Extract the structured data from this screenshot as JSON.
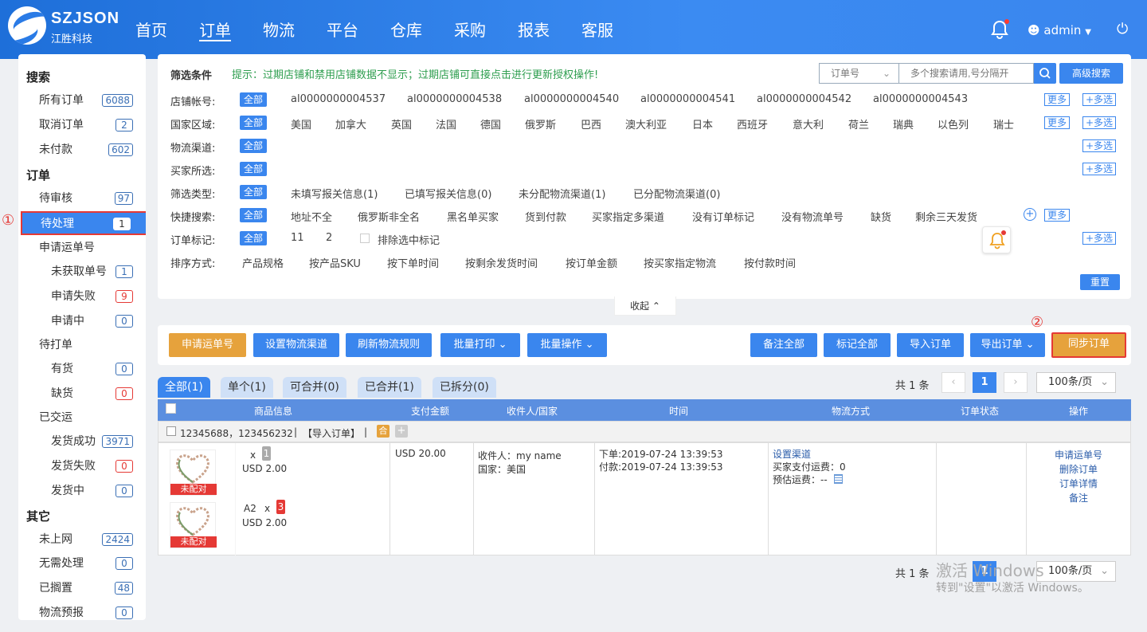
{
  "app": {
    "brand": "SZJSON",
    "brand_sub": "江胜科技"
  },
  "nav": [
    "首页",
    "订单",
    "物流",
    "平台",
    "仓库",
    "采购",
    "报表",
    "客服"
  ],
  "user": {
    "name": "admin"
  },
  "sidebar": {
    "search_heading": "搜索",
    "search_items": [
      {
        "label": "所有订单",
        "count": "6088"
      },
      {
        "label": "取消订单",
        "count": "2"
      },
      {
        "label": "未付款",
        "count": "602"
      }
    ],
    "order_heading": "订单",
    "order_items": [
      {
        "label": "待审核",
        "count": "97"
      },
      {
        "label": "待处理",
        "count": "1"
      }
    ],
    "apply_label": "申请运单号",
    "apply_items": [
      {
        "label": "未获取单号",
        "count": "1"
      },
      {
        "label": "申请失败",
        "count": "9"
      },
      {
        "label": "申请中",
        "count": "0"
      }
    ],
    "print_label": "待打单",
    "print_items": [
      {
        "label": "有货",
        "count": "0"
      },
      {
        "label": "缺货",
        "count": "0"
      }
    ],
    "shipped_label": "已交运",
    "shipped_items": [
      {
        "label": "发货成功",
        "count": "3971"
      },
      {
        "label": "发货失败",
        "count": "0"
      },
      {
        "label": "发货中",
        "count": "0"
      }
    ],
    "other_heading": "其它",
    "other_items": [
      {
        "label": "未上网",
        "count": "2424"
      },
      {
        "label": "无需处理",
        "count": "0"
      },
      {
        "label": "已搁置",
        "count": "48"
      },
      {
        "label": "物流预报",
        "count": "0"
      }
    ]
  },
  "markers": {
    "one": "①",
    "two": "②"
  },
  "filter": {
    "title": "筛选条件",
    "tip": "提示：过期店铺和禁用店铺数据不显示；过期店铺可直接点击进行更新授权操作!",
    "search_field": "订单号",
    "search_placeholder": "多个搜索请用,号分隔开",
    "advanced": "高级搜索",
    "all": "全部",
    "more": "更多",
    "multi": "+多选",
    "reset": "重置",
    "collapse": "收起",
    "rows": {
      "shop": {
        "label": "店铺帐号:",
        "options": [
          "al0000000004537",
          "al0000000004538",
          "al0000000004540",
          "al0000000004541",
          "al0000000004542",
          "al0000000004543"
        ]
      },
      "country": {
        "label": "国家区域:",
        "options": [
          "美国",
          "加拿大",
          "英国",
          "法国",
          "德国",
          "俄罗斯",
          "巴西",
          "澳大利亚",
          "日本",
          "西班牙",
          "意大利",
          "荷兰",
          "瑞典",
          "以色列",
          "瑞士"
        ]
      },
      "logistics": {
        "label": "物流渠道:"
      },
      "buyer": {
        "label": "买家所选:"
      },
      "filter_type": {
        "label": "筛选类型:",
        "options": [
          "未填写报关信息(1)",
          "已填写报关信息(0)",
          "未分配物流渠道(1)",
          "已分配物流渠道(0)"
        ]
      },
      "quick": {
        "label": "快捷搜索:",
        "options": [
          "地址不全",
          "俄罗斯非全名",
          "黑名单买家",
          "货到付款",
          "买家指定多渠道",
          "没有订单标记",
          "没有物流单号",
          "缺货",
          "剩余三天发货"
        ]
      },
      "mark": {
        "label": "订单标记:",
        "options": [
          "11",
          "2"
        ],
        "exclude": "排除选中标记"
      },
      "sort": {
        "label": "排序方式:",
        "options": [
          "产品规格",
          "按产品SKU",
          "按下单时间",
          "按剩余发货时间",
          "按订单金额",
          "按买家指定物流",
          "按付款时间"
        ]
      }
    }
  },
  "actions": {
    "apply": "申请运单号",
    "set_logistics": "设置物流渠道",
    "refresh": "刷新物流规则",
    "batch_print": "批量打印",
    "batch_op": "批量操作",
    "note_all": "备注全部",
    "mark_all": "标记全部",
    "import": "导入订单",
    "export": "导出订单",
    "sync": "同步订单"
  },
  "tabs": [
    "全部(1)",
    "单个(1)",
    "可合并(0)",
    "已合并(1)",
    "已拆分(0)"
  ],
  "pager": {
    "total": "共 1 条",
    "page": "1",
    "size": "100条/页"
  },
  "table": {
    "headers": [
      "商品信息",
      "支付金额",
      "收件人/国家",
      "时间",
      "物流方式",
      "订单状态",
      "操作"
    ],
    "group": {
      "ids": "12345688，123456232",
      "sep": "|",
      "tag": "【导入订单】",
      "merge": "合",
      "plus": "+"
    },
    "order": {
      "products": [
        {
          "name": "",
          "x": "x",
          "qty": "1",
          "price": "USD 2.00",
          "status": "未配对"
        },
        {
          "name": "A2",
          "x": "x",
          "qty": "3",
          "price": "USD 2.00",
          "status": "未配对"
        }
      ],
      "payment": "USD  20.00",
      "recipient": "收件人：my name",
      "country": "国家：美国",
      "order_time": "下单:2019-07-24 13:39:53",
      "pay_time": "付款:2019-07-24 13:39:53",
      "set_channel": "设置渠道",
      "buyer_fee": "买家支付运费：0",
      "est_fee": "预估运费：--",
      "ops": [
        "申请运单号",
        "删除订单",
        "订单详情",
        "备注"
      ]
    }
  },
  "watermark": {
    "line1": "激活 Windows",
    "line2": "转到\"设置\"以激活 Windows。"
  }
}
